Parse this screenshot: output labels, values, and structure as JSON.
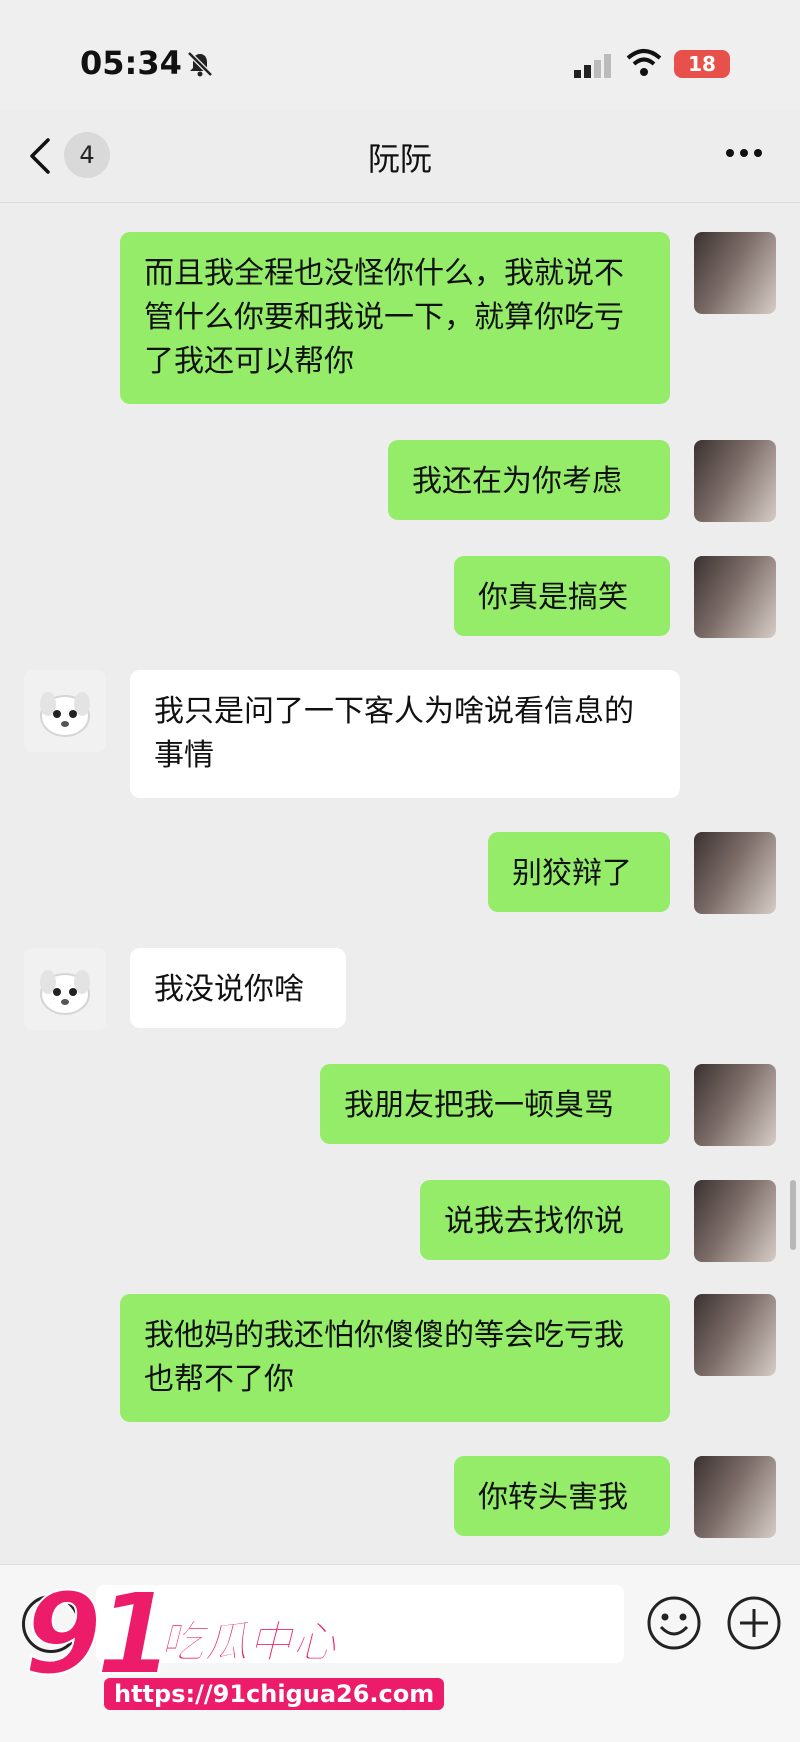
{
  "status_bar": {
    "time": "05:34",
    "battery": "18"
  },
  "header": {
    "unread_count": "4",
    "title": "阮阮"
  },
  "messages": [
    {
      "from": "me",
      "text": "而且我全程也没怪你什么，我就说不管什么你要和我说一下，就算你吃亏了我还可以帮你"
    },
    {
      "from": "me",
      "text": "我还在为你考虑"
    },
    {
      "from": "me",
      "text": "你真是搞笑"
    },
    {
      "from": "other",
      "text": "我只是问了一下客人为啥说看信息的事情"
    },
    {
      "from": "me",
      "text": "别狡辩了"
    },
    {
      "from": "other",
      "text": "我没说你啥"
    },
    {
      "from": "me",
      "text": "我朋友把我一顿臭骂"
    },
    {
      "from": "me",
      "text": "说我去找你说"
    },
    {
      "from": "me",
      "text": "我他妈的我还怕你傻傻的等会吃亏我也帮不了你"
    },
    {
      "from": "me",
      "text": "你转头害我"
    }
  ],
  "watermark": {
    "brand_number": "91",
    "brand_text": "吃瓜中心",
    "url": "https://91chigua26.com"
  },
  "icons": [
    "bell-muted-icon",
    "signal-icon",
    "wifi-icon",
    "battery-icon",
    "back-arrow-icon",
    "more-icon",
    "voice-icon",
    "emoji-icon",
    "plus-icon"
  ],
  "colors": {
    "sent_bubble": "#95ec69",
    "received_bubble": "#ffffff",
    "background": "#ededed",
    "watermark": "#ec1c6b"
  }
}
